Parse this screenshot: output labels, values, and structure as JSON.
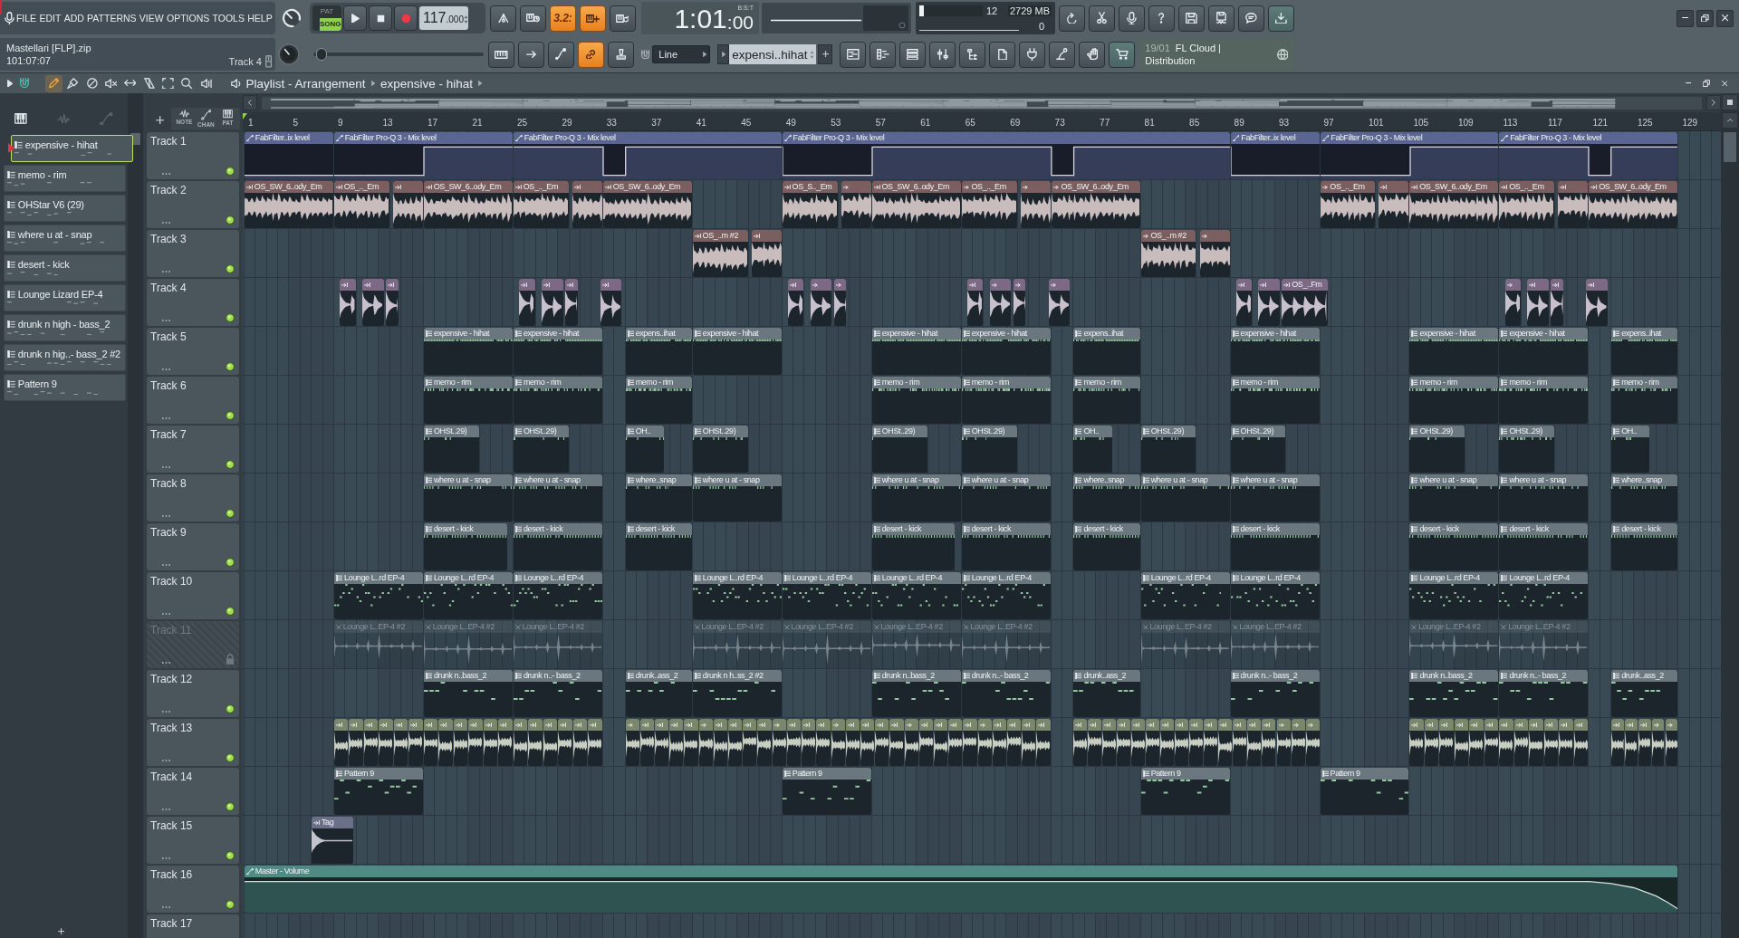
{
  "menu": {
    "items": [
      "FILE",
      "EDIT",
      "ADD",
      "PATTERNS",
      "VIEW",
      "OPTIONS",
      "TOOLS",
      "HELP"
    ]
  },
  "project": {
    "file": "Mastellari [FLP].zip",
    "time": "101:07:07",
    "hint": "Track 4"
  },
  "transport": {
    "modes": [
      {
        "label": "PAT",
        "selected": false
      },
      {
        "label": "SONG",
        "selected": true
      }
    ],
    "tempo": "117",
    "tempo_fraction": ".000"
  },
  "record_options": [
    {
      "kind": "metronome",
      "on": false
    },
    {
      "kind": "wait",
      "on": false
    },
    {
      "kind": "countdown",
      "label": "3.2:",
      "on": true
    },
    {
      "kind": "step-edit",
      "on": true
    },
    {
      "kind": "loop-record",
      "on": false
    }
  ],
  "clock": {
    "main": "1:01",
    "fraction": ":00",
    "format": "B:S:T"
  },
  "monitor": {
    "cpu": {
      "level": 0.07
    },
    "cpu_reading": "12",
    "memory": "2729 MB",
    "polyphony": "0"
  },
  "pitch": {
    "level": 0.03
  },
  "edit_options": [
    {
      "kind": "typing-keyboard",
      "on": false
    },
    {
      "kind": "arrow",
      "on": false
    },
    {
      "kind": "slide",
      "on": false
    },
    {
      "kind": "link",
      "on": true
    },
    {
      "kind": "stamp",
      "on": false
    }
  ],
  "snap": {
    "value": "Line"
  },
  "pattern_selector": {
    "value": "expensi..hihat"
  },
  "cloud": {
    "date": "19/01",
    "title": "FL Cloud |",
    "subtitle": "Distribution"
  },
  "patterns": [
    {
      "name": "expensive - hihat",
      "selected": true
    },
    {
      "name": "memo - rim",
      "selected": false
    },
    {
      "name": "OHStar V6 (29)",
      "selected": false
    },
    {
      "name": "where u at - snap",
      "selected": false
    },
    {
      "name": "desert - kick",
      "selected": false
    },
    {
      "name": "Lounge Lizard EP-4",
      "selected": false
    },
    {
      "name": "drunk n high - bass_2",
      "selected": false
    },
    {
      "name": "drunk n hig..- bass_2 #2",
      "selected": false
    },
    {
      "name": "Pattern 9",
      "selected": false
    }
  ],
  "playlist": {
    "title": "Playlist - Arrangement",
    "pattern": "expensive - hihat",
    "tools": [
      {
        "kind": "draw",
        "selected": true
      },
      {
        "kind": "paint",
        "selected": false
      },
      {
        "kind": "delete",
        "selected": false
      },
      {
        "kind": "mute",
        "selected": false
      },
      {
        "kind": "slip",
        "selected": false
      },
      {
        "kind": "slice",
        "selected": false
      },
      {
        "kind": "select",
        "selected": false
      },
      {
        "kind": "zoom",
        "selected": false
      },
      {
        "kind": "playback",
        "selected": false
      }
    ],
    "columns": [
      "NOTE",
      "CHAN",
      "PAT"
    ],
    "ruler": [
      "1",
      "5",
      "9",
      "13",
      "17",
      "21",
      "25",
      "29",
      "33",
      "37",
      "41",
      "45",
      "49",
      "53",
      "57",
      "61",
      "65",
      "69",
      "73",
      "77",
      "81",
      "85",
      "89",
      "93",
      "97",
      "101",
      "105",
      "109",
      "113",
      "117",
      "121",
      "125",
      "129"
    ],
    "tracks": [
      {
        "name": "Track 1",
        "disabled": false,
        "color": "#5a6592",
        "clips": [
          {
            "kind": "automation",
            "label": "FabFilter..ix level"
          },
          {
            "kind": "automation",
            "label": "FabFilter Pro-Q 3 - Mix level"
          },
          {
            "kind": "automation",
            "label": "FabFilter Pro-Q 3 - Mix level"
          },
          {
            "kind": "automation",
            "label": "FabFilter Pro-Q 3 - Mix level"
          },
          {
            "kind": "automation",
            "label": "FabFilter..ix level"
          },
          {
            "kind": "automation",
            "label": "FabFilter Pro-Q 3 - Mix level"
          },
          {
            "kind": "automation",
            "label": "FabFilter Pro-Q 3 - Mix level"
          }
        ]
      },
      {
        "name": "Track 2",
        "disabled": false,
        "color": "#7b5f60",
        "clips": [
          {
            "kind": "audio",
            "label": "OS_SW_6..ody_Em"
          },
          {
            "kind": "audio",
            "label": "OS_.._Em"
          },
          {
            "kind": "audio"
          },
          {
            "kind": "audio",
            "label": "OS_SW_6..ody_Em"
          },
          {
            "kind": "audio",
            "label": "OS_.._Em"
          },
          {
            "kind": "audio"
          },
          {
            "kind": "audio",
            "label": "OS_SW_6..ody_Em"
          },
          {
            "kind": "audio",
            "label": "OS_S.._Em"
          },
          {
            "kind": "audio"
          },
          {
            "kind": "audio",
            "label": "OS_SW_6..ody_Em"
          },
          {
            "kind": "audio",
            "label": "OS_.._Em"
          },
          {
            "kind": "audio"
          },
          {
            "kind": "audio",
            "label": "OS_SW_6..ody_Em"
          },
          {
            "kind": "audio",
            "label": "OS_.._Em"
          },
          {
            "kind": "audio"
          },
          {
            "kind": "audio",
            "label": "OS_SW_6..ody_Em"
          },
          {
            "kind": "audio",
            "label": "OS_.._Em"
          },
          {
            "kind": "audio"
          },
          {
            "kind": "audio",
            "label": "OS_SW_6..ody_Em"
          }
        ]
      },
      {
        "name": "Track 3",
        "disabled": false,
        "color": "#7b5f60",
        "clips": [
          {
            "kind": "audio",
            "label": "OS_..m #2"
          },
          {
            "kind": "audio"
          },
          {
            "kind": "audio",
            "label": "OS_..m #2"
          },
          {
            "kind": "audio"
          }
        ]
      },
      {
        "name": "Track 4",
        "disabled": false,
        "color": "#7d6886",
        "clips": [
          {
            "kind": "audio"
          },
          {
            "kind": "audio"
          },
          {
            "kind": "audio"
          },
          {
            "kind": "audio"
          },
          {
            "kind": "audio"
          },
          {
            "kind": "audio"
          },
          {
            "kind": "audio"
          },
          {
            "kind": "audio"
          },
          {
            "kind": "audio"
          },
          {
            "kind": "audio"
          },
          {
            "kind": "audio"
          },
          {
            "kind": "audio"
          },
          {
            "kind": "audio"
          },
          {
            "kind": "audio"
          },
          {
            "kind": "audio"
          },
          {
            "kind": "audio"
          },
          {
            "kind": "audio",
            "label": "OS_..Fm"
          },
          {
            "kind": "audio"
          },
          {
            "kind": "audio"
          },
          {
            "kind": "audio"
          },
          {
            "kind": "audio"
          }
        ]
      },
      {
        "name": "Track 5",
        "disabled": false,
        "color": "#6b777e",
        "clips": [
          {
            "kind": "pattern",
            "label": "expensive - hihat"
          },
          {
            "kind": "pattern",
            "label": "expensive - hihat"
          },
          {
            "kind": "pattern",
            "label": "expens..ihat"
          },
          {
            "kind": "pattern",
            "label": "expensive - hihat"
          },
          {
            "kind": "pattern",
            "label": "expensive - hihat"
          },
          {
            "kind": "pattern",
            "label": "expensive - hihat"
          },
          {
            "kind": "pattern",
            "label": "expens..ihat"
          },
          {
            "kind": "pattern",
            "label": "expensive - hihat"
          },
          {
            "kind": "pattern",
            "label": "expensive - hihat"
          },
          {
            "kind": "pattern",
            "label": "expensive - hihat"
          },
          {
            "kind": "pattern",
            "label": "expens..ihat"
          }
        ]
      },
      {
        "name": "Track 6",
        "disabled": false,
        "color": "#6b777e",
        "clips": [
          {
            "kind": "pattern",
            "label": "memo - rim"
          },
          {
            "kind": "pattern",
            "label": "memo - rim"
          },
          {
            "kind": "pattern",
            "label": "memo - rim"
          },
          {
            "kind": "pattern",
            "label": "memo - rim"
          },
          {
            "kind": "pattern",
            "label": "memo - rim"
          },
          {
            "kind": "pattern",
            "label": "memo - rim"
          },
          {
            "kind": "pattern",
            "label": "memo - rim"
          },
          {
            "kind": "pattern",
            "label": "memo - rim"
          },
          {
            "kind": "pattern",
            "label": "memo - rim"
          },
          {
            "kind": "pattern",
            "label": "memo - rim"
          }
        ]
      },
      {
        "name": "Track 7",
        "disabled": false,
        "color": "#6b777e",
        "clips": [
          {
            "kind": "pattern",
            "label": "OHSt..29)"
          },
          {
            "kind": "pattern",
            "label": "OHSt..29)"
          },
          {
            "kind": "pattern",
            "label": "OH.."
          },
          {
            "kind": "pattern",
            "label": "OHSt..29)"
          },
          {
            "kind": "pattern",
            "label": "OHSt..29)"
          },
          {
            "kind": "pattern",
            "label": "OHSt..29)"
          },
          {
            "kind": "pattern",
            "label": "OH.."
          },
          {
            "kind": "pattern",
            "label": "OHSt..29)"
          },
          {
            "kind": "pattern",
            "label": "OHSt..29)"
          },
          {
            "kind": "pattern",
            "label": "OHSt..29)"
          },
          {
            "kind": "pattern",
            "label": "OHSt..29)"
          },
          {
            "kind": "pattern",
            "label": "OH.."
          }
        ]
      },
      {
        "name": "Track 8",
        "disabled": false,
        "color": "#6b777e",
        "clips": [
          {
            "kind": "pattern",
            "label": "where u at - snap"
          },
          {
            "kind": "pattern",
            "label": "where u at - snap"
          },
          {
            "kind": "pattern",
            "label": "where..snap"
          },
          {
            "kind": "pattern",
            "label": "where u at - snap"
          },
          {
            "kind": "pattern",
            "label": "where u at - snap"
          },
          {
            "kind": "pattern",
            "label": "where u at - snap"
          },
          {
            "kind": "pattern",
            "label": "where..snap"
          },
          {
            "kind": "pattern",
            "label": "where u at - snap"
          },
          {
            "kind": "pattern",
            "label": "where u at - snap"
          },
          {
            "kind": "pattern",
            "label": "where u at - snap"
          },
          {
            "kind": "pattern",
            "label": "where u at - snap"
          },
          {
            "kind": "pattern",
            "label": "where..snap"
          }
        ]
      },
      {
        "name": "Track 9",
        "disabled": false,
        "color": "#6b777e",
        "clips": [
          {
            "kind": "pattern",
            "label": "desert - kick"
          },
          {
            "kind": "pattern",
            "label": "desert - kick"
          },
          {
            "kind": "pattern",
            "label": "desert - kick"
          },
          {
            "kind": "pattern",
            "label": "desert - kick"
          },
          {
            "kind": "pattern",
            "label": "desert - kick"
          },
          {
            "kind": "pattern",
            "label": "desert - kick"
          },
          {
            "kind": "pattern",
            "label": "desert - kick"
          },
          {
            "kind": "pattern",
            "label": "desert - kick"
          },
          {
            "kind": "pattern",
            "label": "desert - kick"
          },
          {
            "kind": "pattern",
            "label": "desert - kick"
          }
        ]
      },
      {
        "name": "Track 10",
        "disabled": false,
        "color": "#6b777e",
        "clips": [
          {
            "kind": "pattern",
            "label": "Lounge L..rd EP-4"
          },
          {
            "kind": "pattern",
            "label": "Lounge L..rd EP-4"
          },
          {
            "kind": "pattern",
            "label": "Lounge L..rd EP-4"
          },
          {
            "kind": "pattern",
            "label": "Lounge L..rd EP-4"
          },
          {
            "kind": "pattern",
            "label": "Lounge L..rd EP-4"
          },
          {
            "kind": "pattern",
            "label": "Lounge L..rd EP-4"
          },
          {
            "kind": "pattern",
            "label": "Lounge L..rd EP-4"
          },
          {
            "kind": "pattern",
            "label": "Lounge L..rd EP-4"
          },
          {
            "kind": "pattern",
            "label": "Lounge L..rd EP-4"
          },
          {
            "kind": "pattern",
            "label": "Lounge L..rd EP-4"
          },
          {
            "kind": "pattern",
            "label": "Lounge L..rd EP-4"
          }
        ]
      },
      {
        "name": "Track 11",
        "disabled": true,
        "clips": [
          {
            "kind": "audio",
            "label": "Lounge L..EP-4 #2"
          },
          {
            "kind": "audio",
            "label": "Lounge L..EP-4 #2"
          },
          {
            "kind": "audio",
            "label": "Lounge L..EP-4 #2"
          },
          {
            "kind": "audio",
            "label": "Lounge L..EP-4 #2"
          },
          {
            "kind": "audio",
            "label": "Lounge L..EP-4 #2"
          },
          {
            "kind": "audio",
            "label": "Lounge L..EP-4 #2"
          },
          {
            "kind": "audio",
            "label": "Lounge L..EP-4 #2"
          },
          {
            "kind": "audio",
            "label": "Lounge L..EP-4 #2"
          },
          {
            "kind": "audio",
            "label": "Lounge L..EP-4 #2"
          },
          {
            "kind": "audio",
            "label": "Lounge L..EP-4 #2"
          },
          {
            "kind": "audio",
            "label": "Lounge L..EP-4 #2"
          }
        ]
      },
      {
        "name": "Track 12",
        "disabled": false,
        "color": "#6b777e",
        "clips": [
          {
            "kind": "pattern",
            "label": "drunk n..bass_2"
          },
          {
            "kind": "pattern",
            "label": "drunk n..- bass_2"
          },
          {
            "kind": "pattern",
            "label": "drunk..ass_2"
          },
          {
            "kind": "pattern",
            "label": "drunk n h..ss_2 #2"
          },
          {
            "kind": "pattern",
            "label": "drunk n..bass_2"
          },
          {
            "kind": "pattern",
            "label": "drunk n..- bass_2"
          },
          {
            "kind": "pattern",
            "label": "drunk..ass_2"
          },
          {
            "kind": "pattern",
            "label": "drunk n..- bass_2"
          },
          {
            "kind": "pattern",
            "label": "drunk n..bass_2"
          },
          {
            "kind": "pattern",
            "label": "drunk n..- bass_2"
          },
          {
            "kind": "pattern",
            "label": "drunk..ass_2"
          }
        ]
      },
      {
        "name": "Track 13",
        "disabled": false,
        "color": "#7a876a",
        "clips": [
          {
            "kind": "audio"
          },
          {
            "kind": "audio"
          },
          {
            "kind": "audio"
          },
          {
            "kind": "audio"
          },
          {
            "kind": "audio"
          },
          {
            "kind": "audio"
          },
          {
            "kind": "audio"
          },
          {
            "kind": "audio"
          },
          {
            "kind": "audio"
          },
          {
            "kind": "audio"
          },
          {
            "kind": "audio"
          },
          {
            "kind": "audio"
          },
          {
            "kind": "audio"
          },
          {
            "kind": "audio"
          },
          {
            "kind": "audio"
          },
          {
            "kind": "audio"
          },
          {
            "kind": "audio"
          },
          {
            "kind": "audio"
          },
          {
            "kind": "audio"
          },
          {
            "kind": "audio"
          },
          {
            "kind": "audio"
          },
          {
            "kind": "audio"
          },
          {
            "kind": "audio"
          },
          {
            "kind": "audio"
          },
          {
            "kind": "audio"
          },
          {
            "kind": "audio"
          },
          {
            "kind": "audio"
          },
          {
            "kind": "audio"
          },
          {
            "kind": "audio"
          },
          {
            "kind": "audio"
          },
          {
            "kind": "audio"
          },
          {
            "kind": "audio"
          },
          {
            "kind": "audio"
          },
          {
            "kind": "audio"
          },
          {
            "kind": "audio"
          },
          {
            "kind": "audio"
          },
          {
            "kind": "audio"
          },
          {
            "kind": "audio"
          },
          {
            "kind": "audio"
          },
          {
            "kind": "audio"
          },
          {
            "kind": "audio"
          },
          {
            "kind": "audio"
          },
          {
            "kind": "audio"
          },
          {
            "kind": "audio"
          },
          {
            "kind": "audio"
          },
          {
            "kind": "audio"
          },
          {
            "kind": "audio"
          },
          {
            "kind": "audio"
          },
          {
            "kind": "audio"
          },
          {
            "kind": "audio"
          },
          {
            "kind": "audio"
          },
          {
            "kind": "audio"
          },
          {
            "kind": "audio"
          },
          {
            "kind": "audio"
          },
          {
            "kind": "audio"
          },
          {
            "kind": "audio"
          },
          {
            "kind": "audio"
          },
          {
            "kind": "audio"
          },
          {
            "kind": "audio"
          },
          {
            "kind": "audio"
          },
          {
            "kind": "audio"
          },
          {
            "kind": "audio"
          },
          {
            "kind": "audio"
          },
          {
            "kind": "audio"
          },
          {
            "kind": "audio"
          },
          {
            "kind": "audio"
          },
          {
            "kind": "audio"
          },
          {
            "kind": "audio"
          },
          {
            "kind": "audio"
          },
          {
            "kind": "audio"
          },
          {
            "kind": "audio"
          },
          {
            "kind": "audio"
          },
          {
            "kind": "audio"
          },
          {
            "kind": "audio"
          },
          {
            "kind": "audio"
          },
          {
            "kind": "audio"
          },
          {
            "kind": "audio"
          },
          {
            "kind": "audio"
          },
          {
            "kind": "audio"
          },
          {
            "kind": "audio"
          },
          {
            "kind": "audio"
          }
        ]
      },
      {
        "name": "Track 14",
        "disabled": false,
        "color": "#6b777e",
        "clips": [
          {
            "kind": "pattern",
            "label": "Pattern 9"
          },
          {
            "kind": "pattern",
            "label": "Pattern 9"
          },
          {
            "kind": "pattern",
            "label": "Pattern 9"
          },
          {
            "kind": "pattern",
            "label": "Pattern 9"
          }
        ]
      },
      {
        "name": "Track 15",
        "disabled": false,
        "color": "#6c6f88",
        "clips": [
          {
            "kind": "audio",
            "label": "Tag"
          }
        ]
      },
      {
        "name": "Track 16",
        "disabled": false,
        "color": "#4f8a85",
        "clips": [
          {
            "kind": "automation",
            "label": "Master - Volume"
          }
        ]
      },
      {
        "name": "Track 17",
        "disabled": false
      }
    ]
  }
}
